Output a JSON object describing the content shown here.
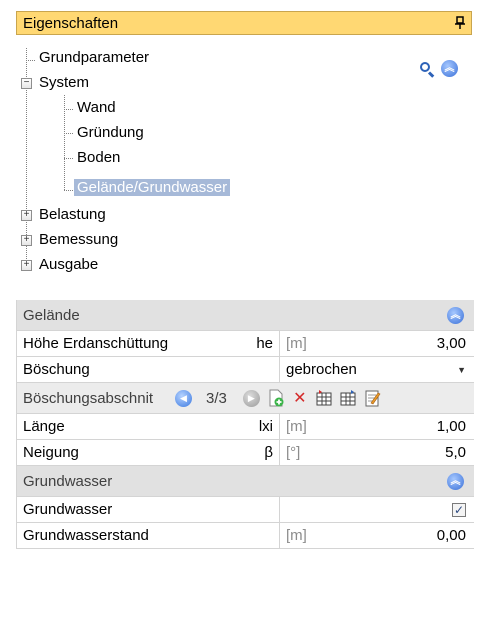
{
  "panel": {
    "title": "Eigenschaften"
  },
  "tree": {
    "items": [
      {
        "label": "Grundparameter"
      },
      {
        "label": "System"
      },
      {
        "label": "Wand"
      },
      {
        "label": "Gründung"
      },
      {
        "label": "Boden"
      },
      {
        "label": "Gelände/Grundwasser"
      },
      {
        "label": "Belastung"
      },
      {
        "label": "Bemessung"
      },
      {
        "label": "Ausgabe"
      }
    ]
  },
  "sections": {
    "gelaende": {
      "title": "Gelände"
    },
    "grundwasser": {
      "title": "Grundwasser"
    }
  },
  "rows": {
    "hoehe": {
      "name": "Höhe Erdanschüttung",
      "symbol": "he",
      "unit": "[m]",
      "value": "3,00"
    },
    "boeschung": {
      "name": "Böschung",
      "value": "gebrochen"
    },
    "abschnitt": {
      "name": "Böschungsabschnit",
      "counter": "3/3"
    },
    "laenge": {
      "name": "Länge",
      "symbol": "lxi",
      "unit": "[m]",
      "value": "1,00"
    },
    "neigung": {
      "name": "Neigung",
      "symbol": "β",
      "unit": "[°]",
      "value": "5,0"
    },
    "gw": {
      "name": "Grundwasser",
      "checked": "✓"
    },
    "gwstand": {
      "name": "Grundwasserstand",
      "unit": "[m]",
      "value": "0,00"
    }
  }
}
